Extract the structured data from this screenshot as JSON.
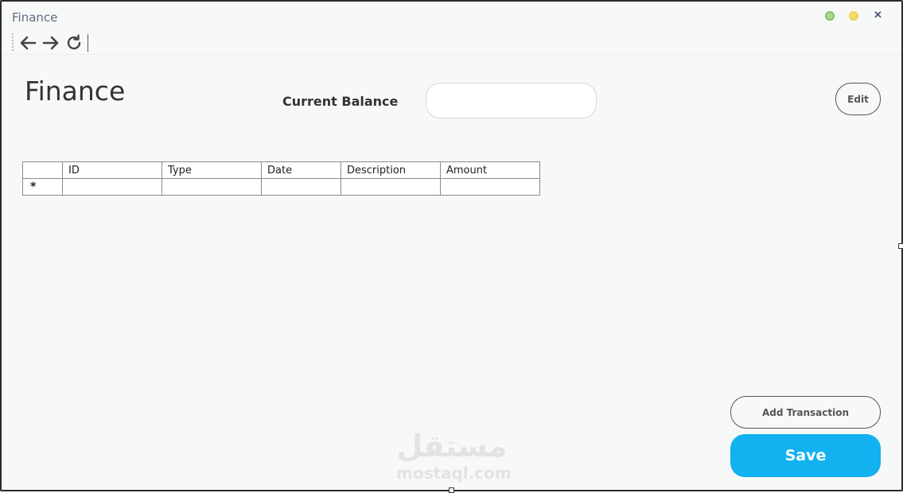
{
  "window": {
    "title": "Finance"
  },
  "toolbar": {
    "icons": [
      "back-arrow-icon",
      "forward-arrow-icon",
      "refresh-icon"
    ]
  },
  "header": {
    "page_title": "Finance",
    "balance_label": "Current Balance",
    "balance_value": "",
    "edit_label": "Edit"
  },
  "grid": {
    "columns": [
      "ID",
      "Type",
      "Date",
      "Description",
      "Amount"
    ],
    "new_row_marker": "*",
    "rows": []
  },
  "actions": {
    "add_transaction_label": "Add Transaction",
    "save_label": "Save"
  },
  "watermark": {
    "arabic": "مستقل",
    "latin": "mostaql.com"
  },
  "colors": {
    "accent": "#12b1f0",
    "background": "#f7f9f8",
    "title_text": "#5d6b82"
  }
}
